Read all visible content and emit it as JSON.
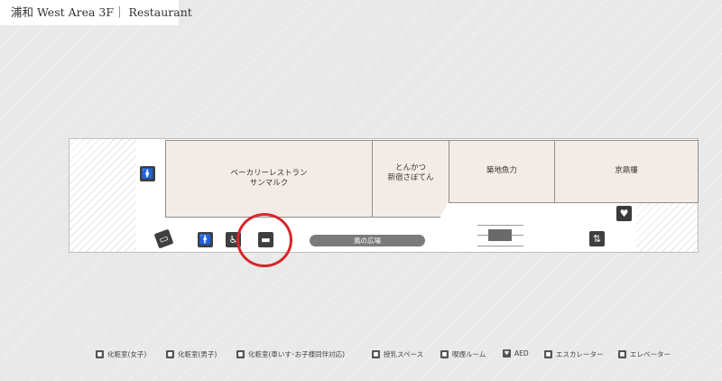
{
  "title": "浦和 West Area 3F｜ Restaurant",
  "stores": [
    {
      "line1": "ベーカリーレストラン",
      "line2": "サンマルク"
    },
    {
      "line1": "とんかつ",
      "line2": "新宿さぼてん"
    },
    {
      "line1": "築地魚力",
      "line2": ""
    },
    {
      "line1": "京鼎樓",
      "line2": ""
    }
  ],
  "plaza_label": "風の広場",
  "colors": {
    "highlight_circle": "#d6262a",
    "store_fill": "#f3ece6"
  },
  "legend": [
    {
      "icon": "restroom-women-icon",
      "label": "化粧室(女子)"
    },
    {
      "icon": "restroom-men-icon",
      "label": "化粧室(男子)"
    },
    {
      "icon": "accessible-restroom-icon",
      "label": "化粧室(車いす･お子様同伴対応)"
    },
    {
      "icon": "nursing-room-icon",
      "label": "授乳スペース"
    },
    {
      "icon": "smoking-room-icon",
      "label": "喫煙ルーム"
    },
    {
      "icon": "aed-icon",
      "label": "AED"
    },
    {
      "icon": "escalator-icon",
      "label": "エスカレーター"
    },
    {
      "icon": "elevator-icon",
      "label": "エレベーター"
    }
  ]
}
